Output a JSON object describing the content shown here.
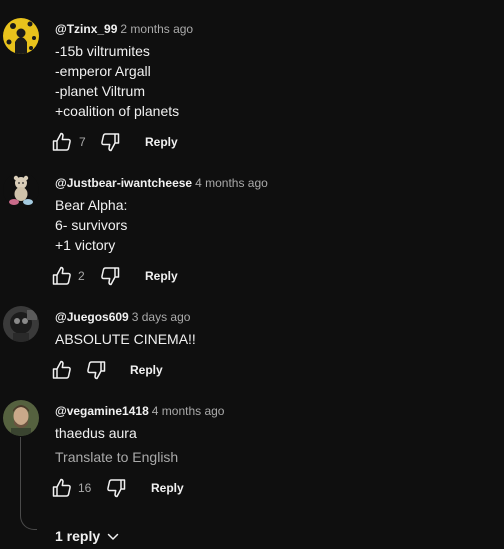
{
  "comments": [
    {
      "author": "@Tzinx_99",
      "timestamp": "2 months ago",
      "lines": [
        "-15b viltrumites",
        "-emperor Argall",
        "-planet Viltrum",
        "+coalition of planets"
      ],
      "likes": "7",
      "reply_label": "Reply"
    },
    {
      "author": "@Justbear-iwantcheese",
      "timestamp": "4 months ago",
      "lines": [
        "Bear Alpha:",
        "6- survivors",
        "+1 victory"
      ],
      "likes": "2",
      "reply_label": "Reply"
    },
    {
      "author": "@Juegos609",
      "timestamp": "3 days ago",
      "lines": [
        "ABSOLUTE CINEMA!!"
      ],
      "likes": "",
      "reply_label": "Reply"
    },
    {
      "author": "@vegamine1418",
      "timestamp": "4 months ago",
      "lines": [
        "thaedus aura"
      ],
      "translate_label": "Translate to English",
      "likes": "16",
      "reply_label": "Reply",
      "replies_toggle": "1 reply"
    }
  ],
  "colors": {
    "background": "#0f0f0f",
    "text_primary": "#f1f1f1",
    "text_secondary": "#aaaaaa"
  },
  "icons": {
    "like": "thumbs-up-icon",
    "dislike": "thumbs-down-icon",
    "expand": "chevron-down-icon"
  }
}
